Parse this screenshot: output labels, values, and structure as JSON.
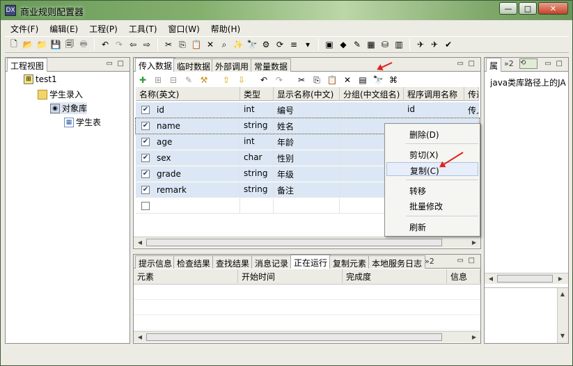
{
  "window": {
    "title": "商业规则配置器",
    "app_icon": "DX",
    "minimize": "—",
    "maximize": "□",
    "close": "✕"
  },
  "menubar": [
    "文件(F)",
    "编辑(E)",
    "工程(P)",
    "工具(T)",
    "窗口(W)",
    "帮助(H)"
  ],
  "toolbar": [
    {
      "icon": "new-file-icon",
      "glyph": "🗋"
    },
    {
      "icon": "open-folder-icon",
      "glyph": "📂"
    },
    {
      "icon": "folder-dim-icon",
      "glyph": "📁",
      "dim": true
    },
    {
      "icon": "save-icon",
      "glyph": "💾"
    },
    {
      "icon": "save-all-icon",
      "glyph": "🗐"
    },
    {
      "icon": "print-icon",
      "glyph": "🖶",
      "dim": true
    },
    {
      "sep": true
    },
    {
      "icon": "undo-icon",
      "glyph": "↶"
    },
    {
      "icon": "redo-icon",
      "glyph": "↷",
      "dim": true
    },
    {
      "icon": "back-arrow-icon",
      "glyph": "⇦"
    },
    {
      "icon": "forward-arrow-icon",
      "glyph": "⇨"
    },
    {
      "sep": true
    },
    {
      "icon": "cut-icon",
      "glyph": "✂"
    },
    {
      "icon": "copy-icon",
      "glyph": "⎘"
    },
    {
      "icon": "paste-icon",
      "glyph": "📋"
    },
    {
      "icon": "delete-icon",
      "glyph": "✕"
    },
    {
      "icon": "find-icon",
      "glyph": "⌕"
    },
    {
      "icon": "wand-icon",
      "glyph": "✨"
    },
    {
      "icon": "binoculars-icon",
      "glyph": "🔭"
    },
    {
      "icon": "properties-icon",
      "glyph": "⚙"
    },
    {
      "icon": "refresh-icon",
      "glyph": "⟳"
    },
    {
      "icon": "indent-icon",
      "glyph": "≡"
    },
    {
      "icon": "dropdown-icon",
      "glyph": "▾"
    },
    {
      "sep": true
    },
    {
      "icon": "package-icon",
      "glyph": "▣"
    },
    {
      "icon": "rule-icon",
      "glyph": "◆"
    },
    {
      "icon": "edit-rule-icon",
      "glyph": "✎"
    },
    {
      "icon": "cube-icon",
      "glyph": "▦"
    },
    {
      "icon": "database-icon",
      "glyph": "⛁"
    },
    {
      "icon": "books-icon",
      "glyph": "▥"
    },
    {
      "sep": true
    },
    {
      "icon": "deploy-icon",
      "glyph": "✈"
    },
    {
      "icon": "deploy-all-icon",
      "glyph": "✈"
    },
    {
      "icon": "deploy-check-icon",
      "glyph": "✔"
    }
  ],
  "project_view": {
    "tab": "工程视图",
    "tree": [
      {
        "label": "test1",
        "icon": "project-icon",
        "level": 0
      },
      {
        "label": "学生录入",
        "icon": "folder-icon",
        "level": 1
      },
      {
        "label": "对象库",
        "icon": "object-library-icon",
        "level": 2,
        "selected": true
      },
      {
        "label": "学生表",
        "icon": "table-icon",
        "level": 3
      }
    ]
  },
  "editor": {
    "tabs": [
      "传入数据",
      "临时数据",
      "外部调用",
      "常量数据"
    ],
    "actions": [
      {
        "icon": "add-icon",
        "glyph": "✚",
        "color": "#2f9d2f"
      },
      {
        "icon": "insert-icon",
        "glyph": "⊞",
        "dim": true
      },
      {
        "icon": "insert-child-icon",
        "glyph": "⊟",
        "dim": true
      },
      {
        "icon": "pin-icon",
        "glyph": "✎",
        "dim": true
      },
      {
        "icon": "link-icon",
        "glyph": "⚒",
        "color": "#c78a10"
      },
      {
        "icon": "move-up-icon",
        "glyph": "⇧",
        "color": "#d8a000"
      },
      {
        "icon": "move-down-icon",
        "glyph": "⇩",
        "color": "#d8a000"
      },
      {
        "icon": "undo-icon",
        "glyph": "↶"
      },
      {
        "icon": "redo-icon",
        "glyph": "↷",
        "dim": true
      },
      {
        "icon": "cut-icon",
        "glyph": "✂"
      },
      {
        "icon": "copy-icon",
        "glyph": "⎘"
      },
      {
        "icon": "paste-icon",
        "glyph": "📋"
      },
      {
        "icon": "delete-icon",
        "glyph": "✕"
      },
      {
        "icon": "export-icon",
        "glyph": "▤"
      },
      {
        "icon": "binoculars-icon",
        "glyph": "🔭"
      },
      {
        "icon": "format-icon",
        "glyph": "⌘"
      }
    ],
    "columns": [
      "名称(英文)",
      "类型",
      "显示名称(中文)",
      "分组(中文组名)",
      "程序调用名称",
      "传递"
    ],
    "rows": [
      {
        "checked": true,
        "name": "id",
        "type": "int",
        "display": "编号",
        "group": "",
        "call": "id",
        "pass": "传入"
      },
      {
        "checked": true,
        "name": "name",
        "type": "string",
        "display": "姓名",
        "group": "",
        "call": "",
        "pass": ""
      },
      {
        "checked": true,
        "name": "age",
        "type": "int",
        "display": "年龄",
        "group": "",
        "call": "",
        "pass": ""
      },
      {
        "checked": true,
        "name": "sex",
        "type": "char",
        "display": "性别",
        "group": "",
        "call": "",
        "pass": ""
      },
      {
        "checked": true,
        "name": "grade",
        "type": "string",
        "display": "年级",
        "group": "",
        "call": "",
        "pass": ""
      },
      {
        "checked": true,
        "name": "remark",
        "type": "string",
        "display": "备注",
        "group": "",
        "call": "",
        "pass": ""
      },
      {
        "checked": false,
        "name": "",
        "type": "",
        "display": "",
        "group": "",
        "call": "",
        "pass": ""
      }
    ]
  },
  "context_menu": [
    "删除(D)",
    "剪切(X)",
    "复制(C)",
    "转移",
    "批量修改",
    "刷新"
  ],
  "bottom": {
    "tabs": [
      "提示信息",
      "检查结果",
      "查找结果",
      "消息记录",
      "正在运行",
      "复制元素",
      "本地服务日志"
    ],
    "overflow": "»2",
    "columns": [
      "元素",
      "开始时间",
      "完成度",
      "信息"
    ]
  },
  "right_panel": {
    "tab": "属",
    "overflow": "»2",
    "text": "java类库路径上的JA"
  }
}
